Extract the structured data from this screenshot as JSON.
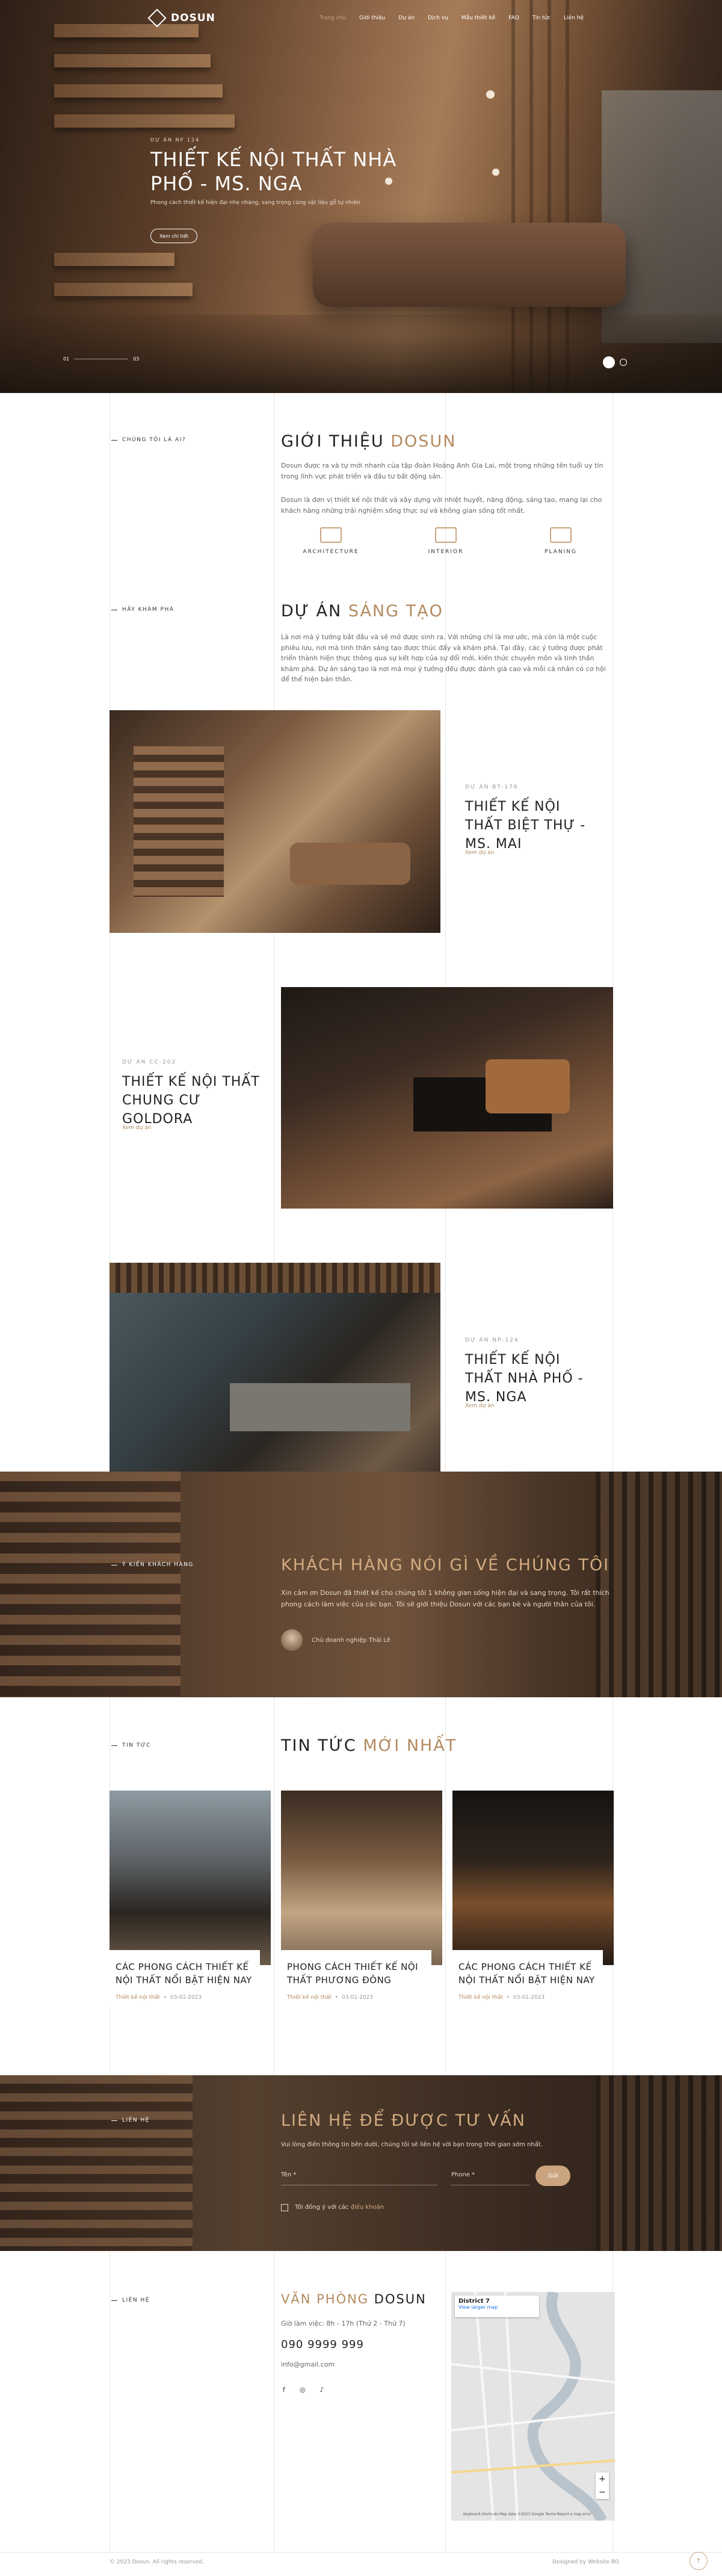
{
  "nav": {
    "brand": "DOSUN",
    "items": [
      "Trang chủ",
      "Giới thiệu",
      "Dự án",
      "Dịch vụ",
      "Mẫu thiết kế",
      "FAQ",
      "Tin tức",
      "Liên hệ"
    ]
  },
  "hero": {
    "tag": "DỰ ÁN NP 124",
    "title": "THIẾT KẾ NỘI THẤT NHÀ PHỐ - MS. NGA",
    "desc": "Phong cách thiết kế hiện đại nhẹ nhàng, sang trọng cùng vật liệu gỗ tự nhiên",
    "button": "Xem chi tiết",
    "progress_start": "01",
    "progress_end": "03"
  },
  "about": {
    "label": "CHÚNG TÔI LÀ AI?",
    "title_a": "GIỚI THIỆU",
    "title_b": "DOSUN",
    "p1": "Dosun được ra và tự mới nhanh của tập đoàn Hoàng Anh Gia Lai, một trong những tên tuổi uy tín trong lĩnh vực phát triển và đầu tư bất động sản.",
    "p2": "Dosun là đơn vị thiết kế nội thất và xây dựng với nhiệt huyết, năng động, sáng tạo, mang lại cho khách hàng những trải nghiệm sống thực sự và không gian sống tốt nhất.",
    "features": [
      "ARCHITECTURE",
      "INTERIOR",
      "PLANING"
    ]
  },
  "projects": {
    "label": "HÃY KHÁM PHÁ",
    "title_a": "DỰ ÁN",
    "title_b": "SÁNG TẠO",
    "desc": "Là nơi mà ý tưởng bắt đầu và sẽ mở được sinh ra. Với những chỉ là mơ ước, mà còn là một cuộc phiêu lưu, nơi mà tinh thần sáng tạo được thúc đẩy và khám phá. Tại đây, các ý tưởng được phát triển thành hiện thực thông qua sự kết hợp của sự đổi mới, kiến thức chuyên môn và tinh thần khám phá. Dự án sáng tạo là nơi mà mọi ý tưởng đều được đánh giá cao và mỗi cá nhân có cơ hội để thể hiện bản thân.",
    "items": [
      {
        "code": "DỰ ÁN BT-176",
        "title": "THIẾT KẾ NỘI THẤT BIỆT THỰ - MS. MAI",
        "link": "Xem dự án"
      },
      {
        "code": "DỰ ÁN CC-202",
        "title": "THIẾT KẾ NỘI THẤT CHUNG CƯ GOLDORA",
        "link": "Xem dự án"
      },
      {
        "code": "DỰ ÁN NP-124",
        "title": "THIẾT KẾ NỘI THẤT NHÀ PHỐ - MS. NGA",
        "link": "Xem dự án"
      }
    ]
  },
  "testimonial": {
    "label": "Ý KIẾN KHÁCH HÀNG",
    "title": "KHÁCH HÀNG NÓI GÌ VỀ CHÚNG TÔI",
    "quote": "Xin cảm ơn Dosun đã thiết kế cho chúng tôi 1 không gian sống hiện đại và sang trọng. Tôi rất thích phong cách làm việc của các bạn. Tôi sẽ giới thiệu Dosun với các bạn bè và người thân của tôi.",
    "author": "Chủ doanh nghiệp Thái Lê"
  },
  "news": {
    "label": "TIN TỨC",
    "title_a": "TIN TỨC",
    "title_b": "MỚI NHẤT",
    "items": [
      {
        "title": "CÁC PHONG CÁCH THIẾT KẾ NỘI THẤT NỔI BẬT HIỆN NAY",
        "category": "Thiết kế nội thất",
        "date": "03-01-2023"
      },
      {
        "title": "PHONG CÁCH THIẾT KẾ NỘI THẤT PHƯƠNG ĐÔNG",
        "category": "Thiết kế nội thất",
        "date": "03-01-2023"
      },
      {
        "title": "CÁC PHONG CÁCH THIẾT KẾ NỘI THẤT NỔI BẬT HIỆN NAY",
        "category": "Thiết kế nội thất",
        "date": "03-01-2023"
      }
    ]
  },
  "contact": {
    "label": "LIÊN HỆ",
    "title": "LIÊN HỆ ĐỂ ĐƯỢC TƯ VẤN",
    "desc": "Vui lòng điền thông tin bên dưới, chúng tôi sẽ liên hệ với bạn trong thời gian sớm nhất.",
    "name_label": "Tên *",
    "phone_label": "Phone *",
    "submit": "Gửi",
    "consent": "Tôi đồng ý với các",
    "consent_link": "điều khoản"
  },
  "office": {
    "label": "LIÊN HỆ",
    "title_a": "VĂN PHÒNG",
    "title_b": "DOSUN",
    "hours": "Giờ làm việc: 8h - 17h (Thứ 2 - Thứ 7)",
    "phone": "090 9999 999",
    "email": "info@gmail.com",
    "map_title": "District 7",
    "map_link": "View larger map",
    "map_footer": "Keyboard shortcuts   Map data ©2023 Google   Terms   Report a map error"
  },
  "footer": {
    "copyright": "© 2023 Dosun. All rights reserved.",
    "credit": "Designed by Website BG"
  }
}
